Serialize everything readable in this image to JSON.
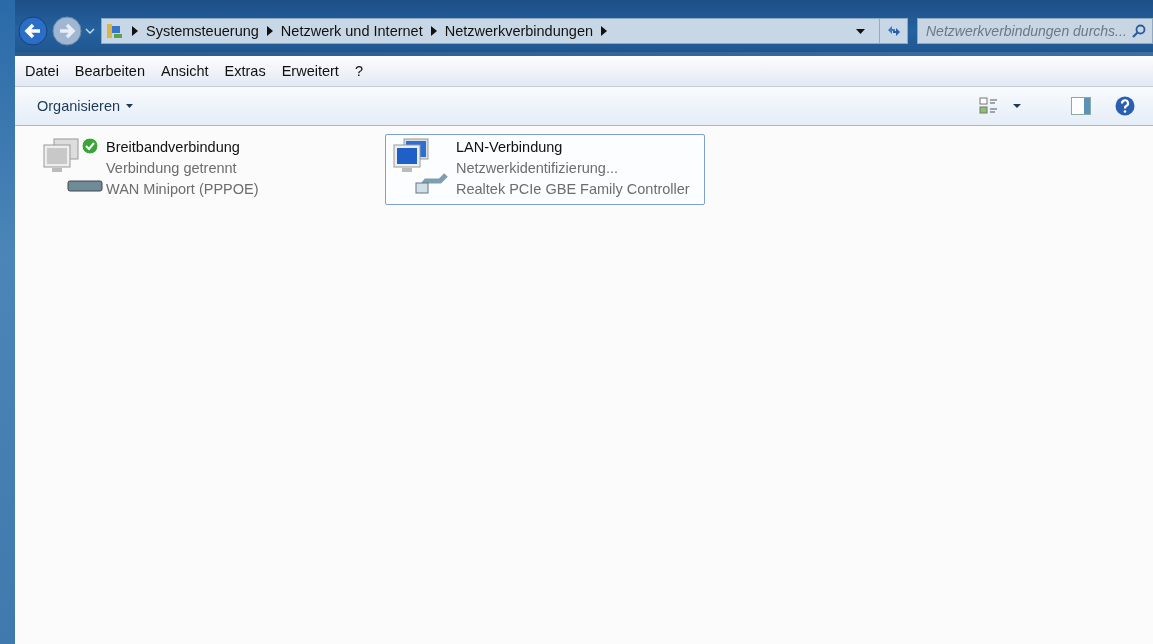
{
  "breadcrumb": [
    "Systemsteuerung",
    "Netzwerk und Internet",
    "Netzwerkverbindungen"
  ],
  "search": {
    "placeholder": "Netzwerkverbindungen durchs..."
  },
  "menu": [
    "Datei",
    "Bearbeiten",
    "Ansicht",
    "Extras",
    "Erweitert",
    "?"
  ],
  "toolbar": {
    "organize": "Organisieren"
  },
  "connections": [
    {
      "kind": "broadband",
      "name": "Breitbandverbindung",
      "status": "Verbindung getrennt",
      "device": "WAN Miniport (PPPOE)",
      "selected": false
    },
    {
      "kind": "lan",
      "name": "LAN-Verbindung",
      "status": "Netzwerkidentifizierung...",
      "device": "Realtek PCIe GBE Family Controller",
      "selected": true
    }
  ]
}
